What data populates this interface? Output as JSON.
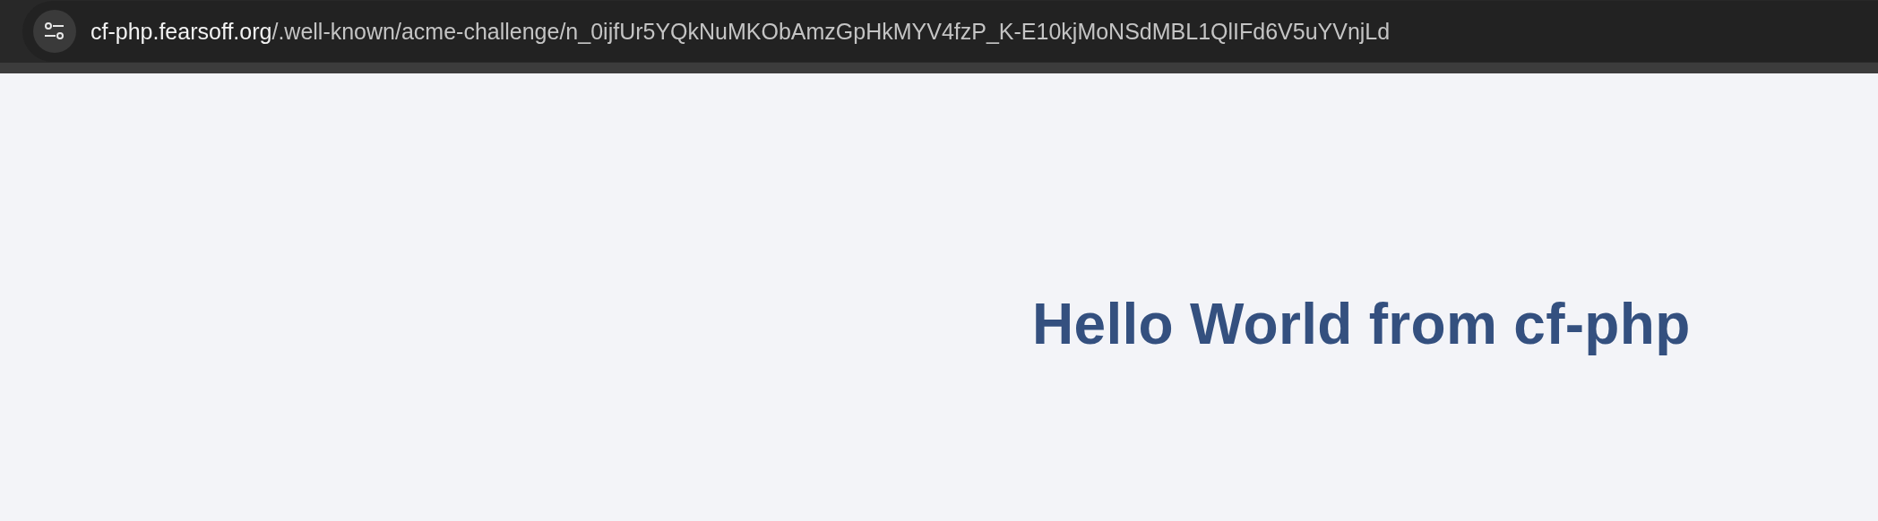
{
  "address_bar": {
    "host": "cf-php.fearsoff.org",
    "path": "/.well-known/acme-challenge/n_0ijfUr5YQkNuMKObAmzGpHkMYV4fzP_K-E10kjMoNSdMBL1QlIFd6V5uYVnjLd"
  },
  "page": {
    "heading": "Hello World from cf-php"
  }
}
